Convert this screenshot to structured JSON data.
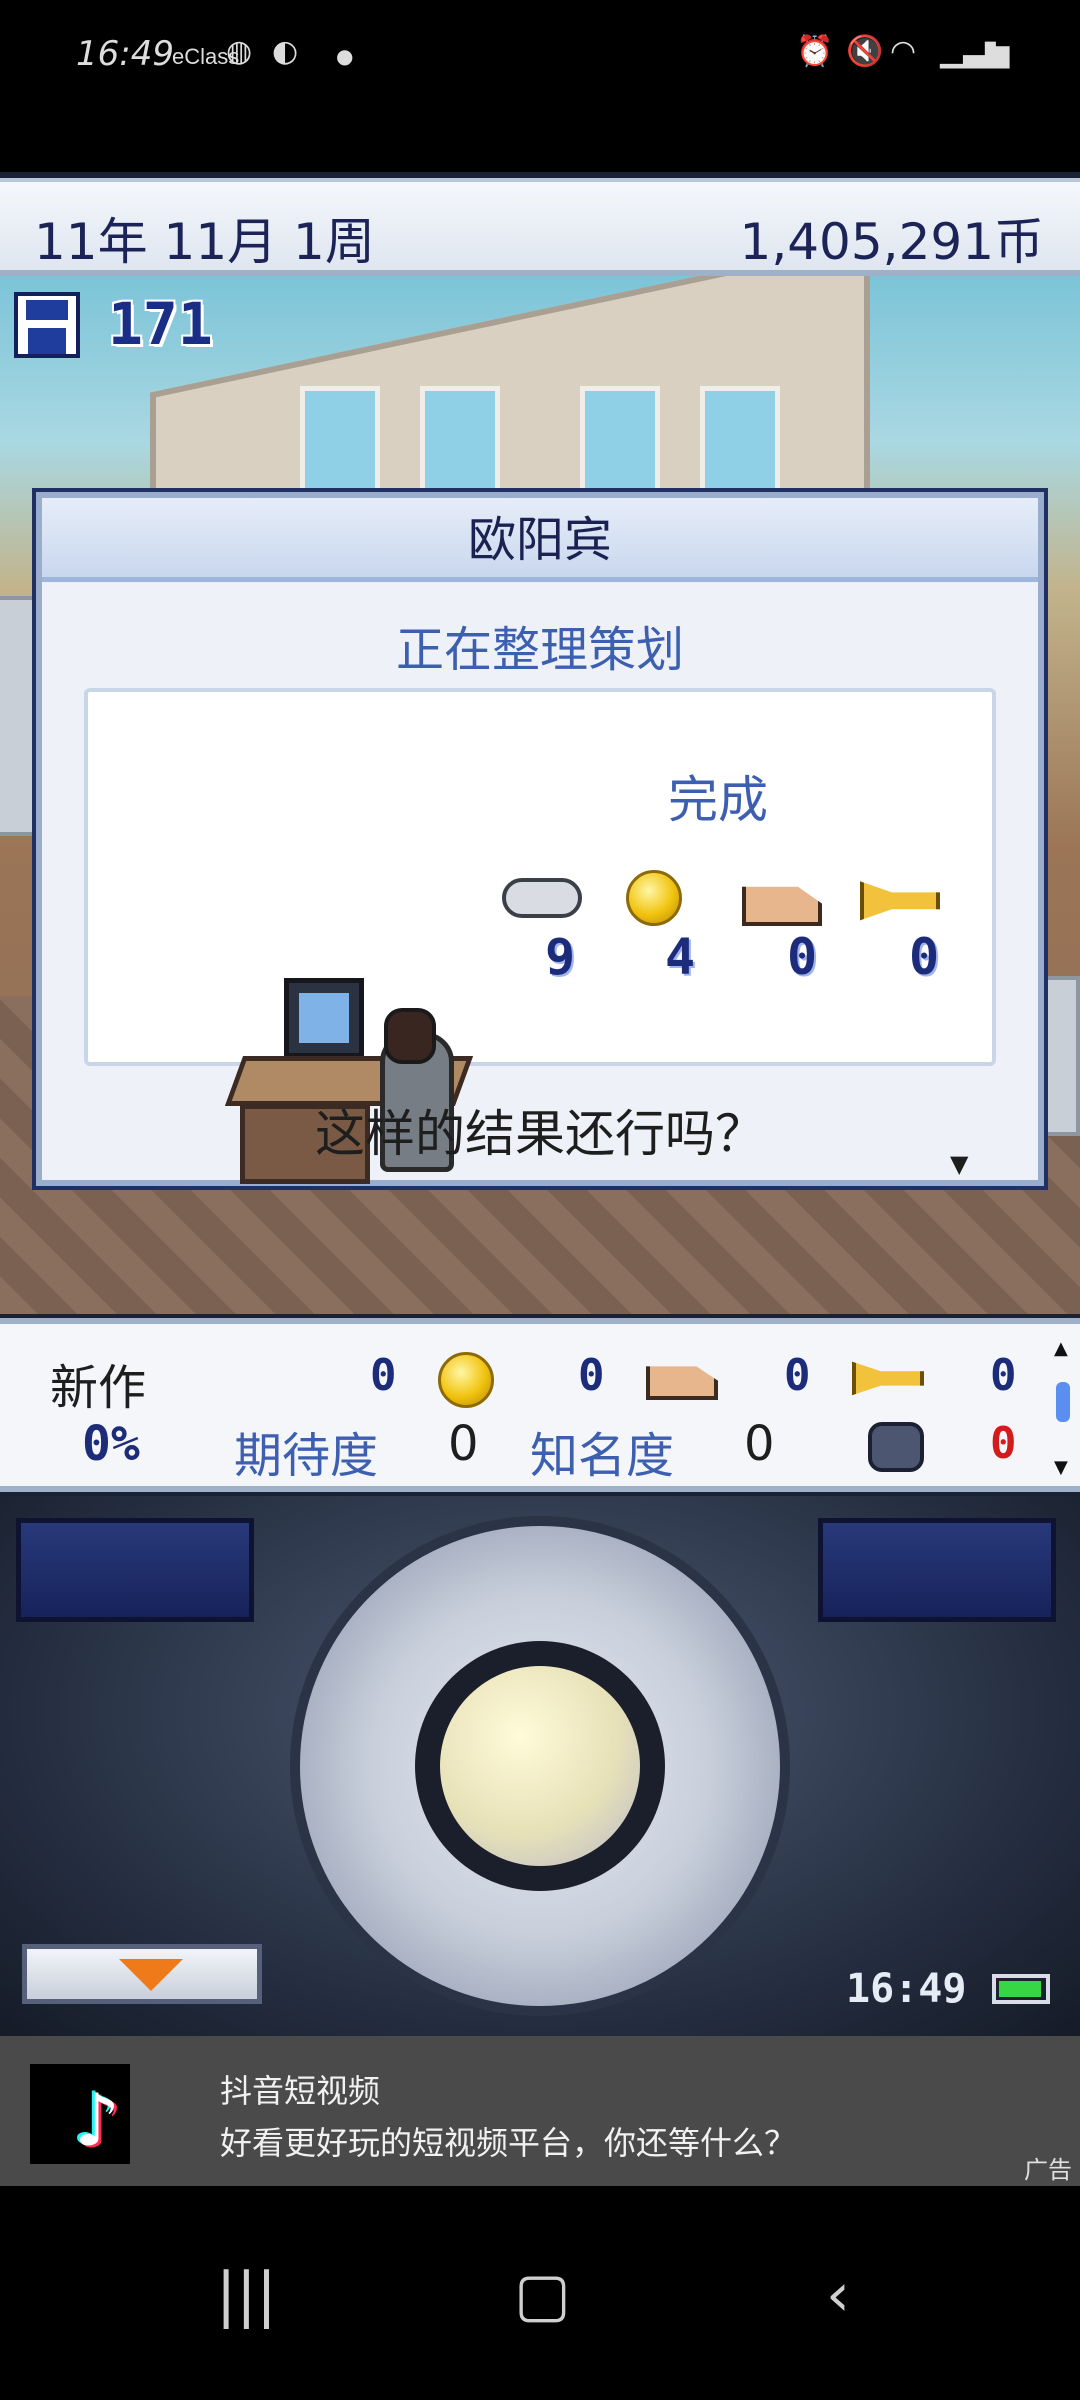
{
  "status_bar": {
    "time": "16:49",
    "eclass": "eClass",
    "left_icons": [
      "basketball-icon",
      "globe-icon",
      "dot-icon"
    ],
    "right_icons": [
      "alarm-icon",
      "mute-icon",
      "wifi-icon",
      "signal-icon",
      "battery-icon"
    ]
  },
  "game": {
    "date": "11年 11月 1周",
    "money": "1,405,291币",
    "save_count": "171"
  },
  "dialog": {
    "title": "欧阳宾",
    "subtitle": "正在整理策划",
    "status": "完成",
    "stats": [
      {
        "icon": "gamepad-icon",
        "value": "9"
      },
      {
        "icon": "bulb-icon",
        "value": "4"
      },
      {
        "icon": "paint-icon",
        "value": "0"
      },
      {
        "icon": "trumpet-icon",
        "value": "0"
      }
    ],
    "question": "这样的结果还行吗？"
  },
  "info": {
    "new_label": "新作",
    "percent": "0%",
    "stats": [
      "0",
      "0",
      "0",
      "0"
    ],
    "expectation_label": "期待度",
    "expectation_value": "0",
    "fame_label": "知名度",
    "fame_value": "0",
    "bug_value": "0"
  },
  "controller": {
    "clock": "16:49",
    "battery_level": 1.0
  },
  "ad": {
    "title": "抖音短视频",
    "subtitle": "好看更好玩的短视频平台，你还等什么？",
    "tag": "广告"
  },
  "colors": {
    "accent_blue": "#3d5fb0",
    "navy": "#1c2356",
    "bug_red": "#d21b1b"
  }
}
